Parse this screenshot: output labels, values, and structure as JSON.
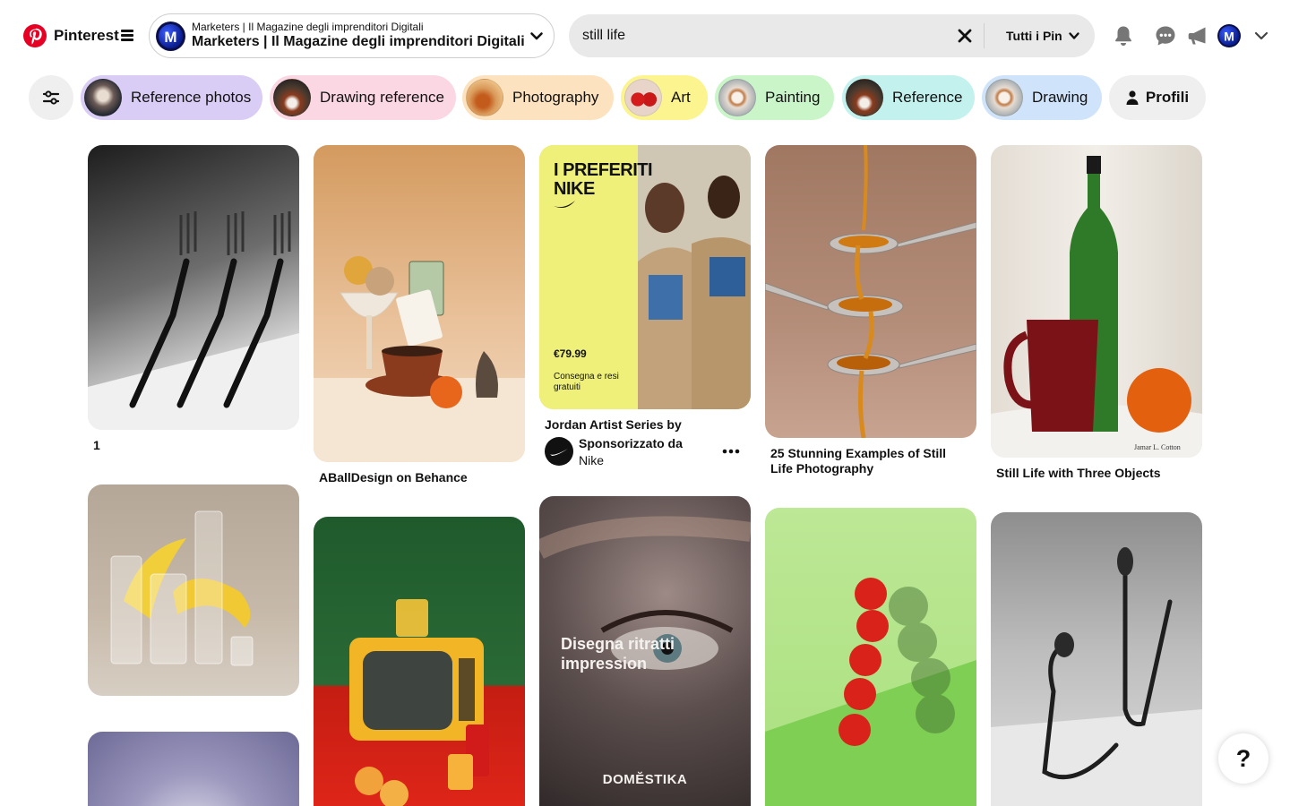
{
  "brand": {
    "name": "Pinterest",
    "color": "#e60023"
  },
  "account": {
    "subtitle": "Marketers | Il Magazine degli imprenditori Digitali",
    "name": "Marketers | Il Magazine degli imprenditori Digitali"
  },
  "search": {
    "value": "still life",
    "filter_label": "Tutti i Pin"
  },
  "header_icons": [
    "bell-icon",
    "chat-icon",
    "megaphone-icon",
    "avatar",
    "chevron-down-icon"
  ],
  "chips": [
    {
      "label": "Reference photos",
      "color": "#d9ccf5"
    },
    {
      "label": "Drawing reference",
      "color": "#fbd6e3"
    },
    {
      "label": "Photography",
      "color": "#fde2bf"
    },
    {
      "label": "Art",
      "color": "#fbf48f"
    },
    {
      "label": "Painting",
      "color": "#c9f5c8"
    },
    {
      "label": "Reference",
      "color": "#c2f1ee"
    },
    {
      "label": "Drawing",
      "color": "#cfe4fa"
    }
  ],
  "profile_chip": {
    "label": "Profili"
  },
  "pins": [
    {
      "title": "1"
    },
    {
      "title": "ABallDesign on Behance"
    },
    {
      "sponsored": true,
      "title": "Jordan Artist Series by",
      "sponsored_label": "Sponsorizzato da",
      "advertiser": "Nike",
      "ad_headline_1": "I PREFERITI",
      "ad_headline_2": "NIKE",
      "ad_price": "€79.99",
      "ad_shipping_1": "Consegna e resi",
      "ad_shipping_2": "gratuiti"
    },
    {
      "title": "25 Stunning Examples of Still Life Photography"
    },
    {
      "title": "Still Life with Three Objects",
      "watermark": "Jamar L. Cotton"
    }
  ],
  "domestika_ad": {
    "line1": "Disegna ritratti",
    "line2": "impression",
    "brand": "DOMĔSTIKA"
  },
  "help": {
    "label": "?"
  }
}
